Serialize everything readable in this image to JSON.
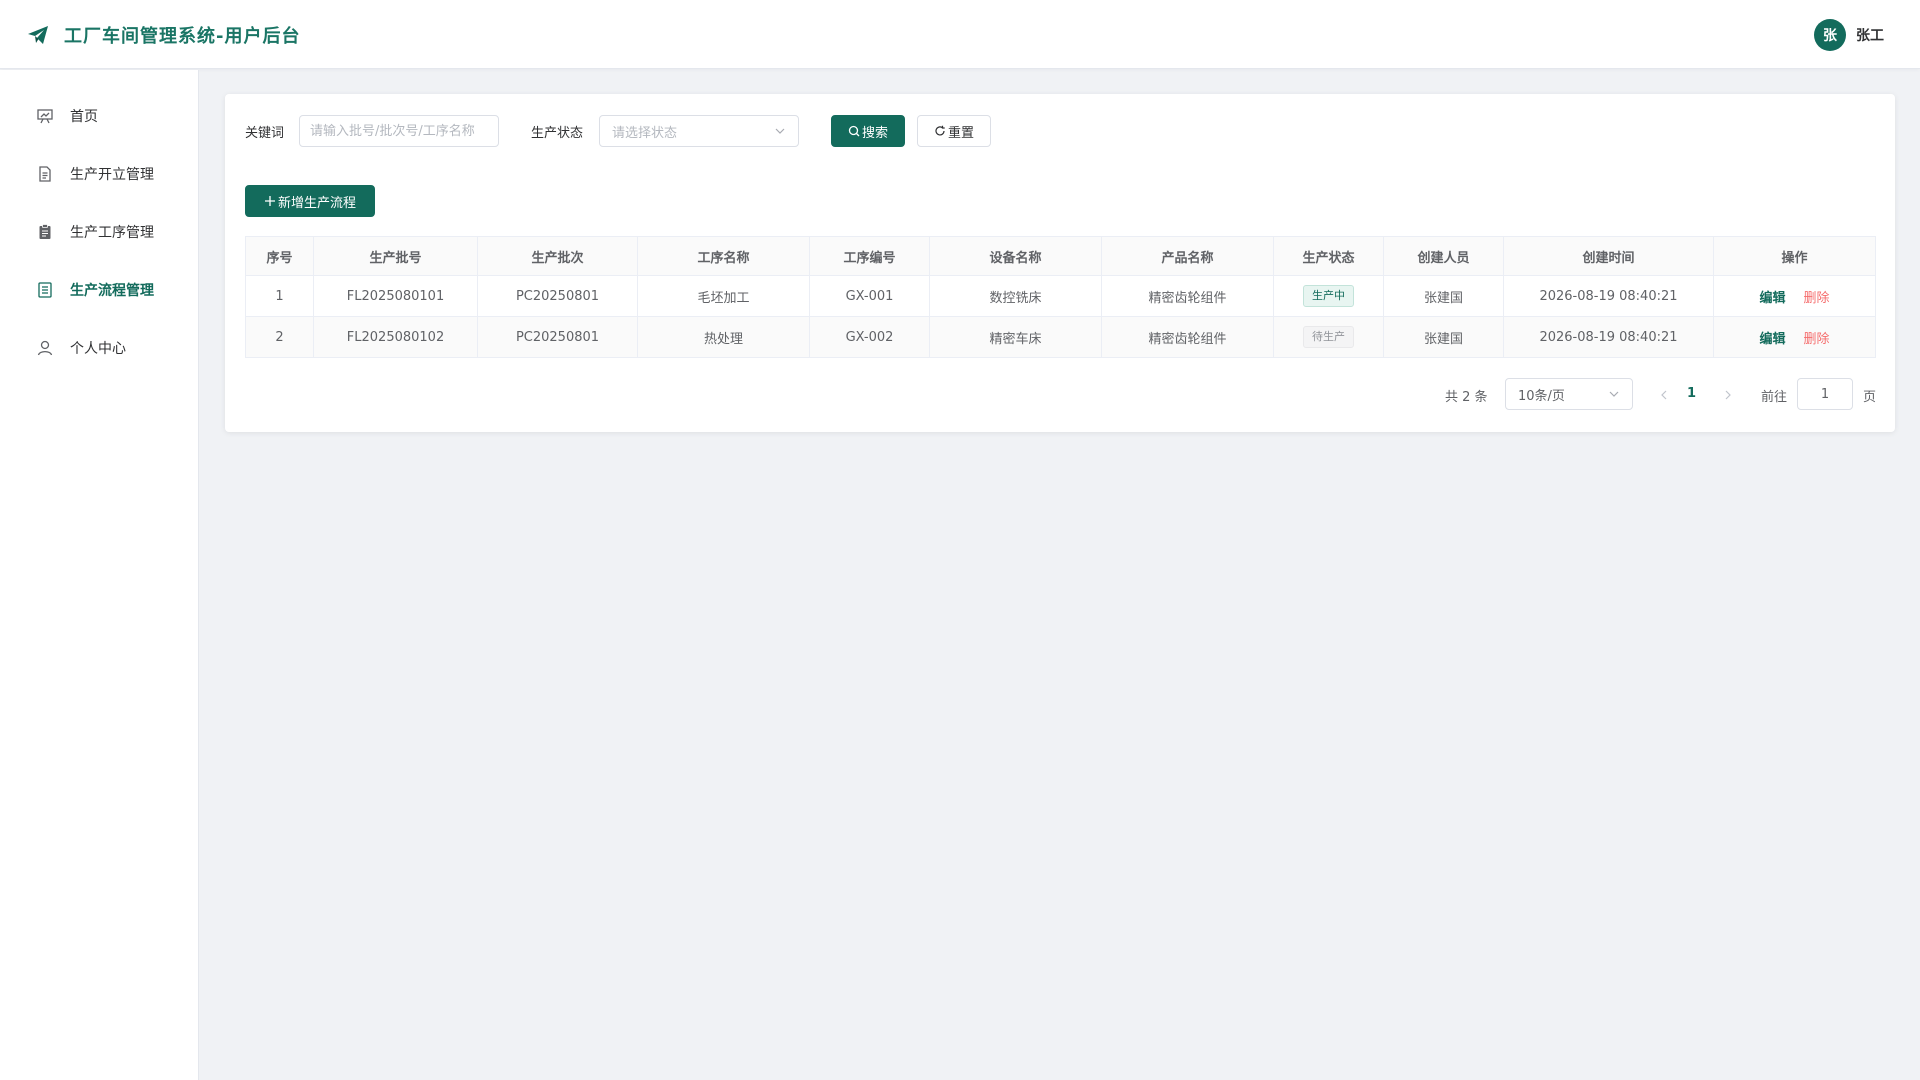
{
  "header": {
    "title": "工厂车间管理系统-用户后台",
    "avatar_text": "张",
    "user_name": "张工"
  },
  "sidebar": {
    "items": [
      {
        "label": "首页",
        "icon": "presentation-icon"
      },
      {
        "label": "生产开立管理",
        "icon": "document-icon"
      },
      {
        "label": "生产工序管理",
        "icon": "clipboard-icon"
      },
      {
        "label": "生产流程管理",
        "icon": "list-document-icon",
        "active": true
      },
      {
        "label": "个人中心",
        "icon": "user-icon"
      }
    ]
  },
  "filters": {
    "keyword_label": "关键词",
    "keyword_placeholder": "请输入批号/批次号/工序名称",
    "status_label": "生产状态",
    "status_placeholder": "请选择状态",
    "search_label": "搜索",
    "reset_label": "重置"
  },
  "actions": {
    "add_label": "新增生产流程"
  },
  "table": {
    "columns": [
      "序号",
      "生产批号",
      "生产批次",
      "工序名称",
      "工序编号",
      "设备名称",
      "产品名称",
      "生产状态",
      "创建人员",
      "创建时间",
      "操作"
    ],
    "rows": [
      {
        "index": "1",
        "batch_no": "FL2025080101",
        "batch": "PC20250801",
        "process_name": "毛坯加工",
        "process_code": "GX-001",
        "equipment": "数控铣床",
        "product": "精密齿轮组件",
        "status": "生产中",
        "creator": "张建国",
        "created_at": "2026-08-19 08:40:21",
        "edit": "编辑",
        "delete": "删除"
      },
      {
        "index": "2",
        "batch_no": "FL2025080102",
        "batch": "PC20250801",
        "process_name": "热处理",
        "process_code": "GX-002",
        "equipment": "精密车床",
        "product": "精密齿轮组件",
        "status": "待生产",
        "creator": "张建国",
        "created_at": "2026-08-19 08:40:21",
        "edit": "编辑",
        "delete": "删除"
      }
    ]
  },
  "pagination": {
    "total_text": "共 2 条",
    "page_size": "10条/页",
    "current_page": "1",
    "goto_label": "前往",
    "goto_value": "1",
    "page_suffix": "页"
  },
  "colors": {
    "primary": "#136b5c",
    "danger": "#f56c6c",
    "background": "#f0f2f5"
  }
}
